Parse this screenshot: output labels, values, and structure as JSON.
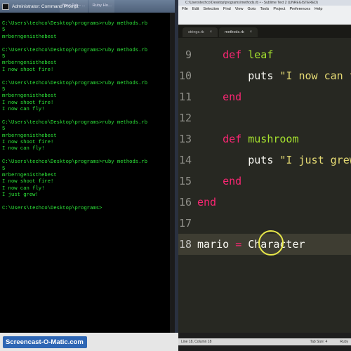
{
  "cmd": {
    "title": "Administrator: Command Prompt",
    "lines": [
      "C:\\Users\\techco\\Desktop\\programs>ruby methods.rb",
      "5",
      "mrberngenisthebest",
      "",
      "C:\\Users\\techco\\Desktop\\programs>ruby methods.rb",
      "5",
      "mrberngenisthebest",
      "I now shoot fire!",
      "",
      "C:\\Users\\techco\\Desktop\\programs>ruby methods.rb",
      "5",
      "mrberngenisthebest",
      "I now shoot fire!",
      "I now can fly!",
      "",
      "C:\\Users\\techco\\Desktop\\programs>ruby methods.rb",
      "5",
      "mrberngenisthebest",
      "I now shoot fire!",
      "I now can fly!",
      "",
      "C:\\Users\\techco\\Desktop\\programs>ruby methods.rb",
      "5",
      "mrberngenisthebest",
      "I now shoot fire!",
      "I now can fly!",
      "I just grew!",
      "",
      "C:\\Users\\techco\\Desktop\\programs>"
    ]
  },
  "taskbar_peek": [
    "New Tab - ...",
    "Ruby Ho..."
  ],
  "sublime": {
    "title": "C:\\Users\\techco\\Desktop\\programs\\methods.rb • - Sublime Text 2 (UNREGISTERED)",
    "menus": [
      "File",
      "Edit",
      "Selection",
      "Find",
      "View",
      "Goto",
      "Tools",
      "Project",
      "Preferences",
      "Help"
    ],
    "tabs": [
      {
        "label": "strings.rb",
        "close": "×"
      },
      {
        "label": "methods.rb",
        "close": "×"
      }
    ],
    "lines": [
      {
        "n": "9",
        "indent": "    ",
        "parts": [
          [
            "kw",
            "def"
          ],
          [
            "txt",
            " "
          ],
          [
            "fn",
            "leaf"
          ]
        ]
      },
      {
        "n": "10",
        "indent": "        ",
        "parts": [
          [
            "txt",
            "puts "
          ],
          [
            "str",
            "\"I now can fly!\""
          ]
        ]
      },
      {
        "n": "11",
        "indent": "    ",
        "parts": [
          [
            "kw",
            "end"
          ]
        ]
      },
      {
        "n": "12",
        "indent": "",
        "parts": []
      },
      {
        "n": "13",
        "indent": "    ",
        "parts": [
          [
            "kw",
            "def"
          ],
          [
            "txt",
            " "
          ],
          [
            "fn",
            "mushroom"
          ]
        ]
      },
      {
        "n": "14",
        "indent": "        ",
        "parts": [
          [
            "txt",
            "puts "
          ],
          [
            "str",
            "\"I just grew!\""
          ]
        ]
      },
      {
        "n": "15",
        "indent": "    ",
        "parts": [
          [
            "kw",
            "end"
          ]
        ]
      },
      {
        "n": "16",
        "indent": "",
        "parts": [
          [
            "kw",
            "end"
          ]
        ]
      },
      {
        "n": "17",
        "indent": "",
        "parts": []
      },
      {
        "n": "18",
        "indent": "",
        "parts": [
          [
            "txt",
            "mario "
          ],
          [
            "op",
            "="
          ],
          [
            "txt",
            " Character"
          ]
        ]
      }
    ],
    "current_line": "18",
    "status": {
      "position": "Line 18, Column 18",
      "tab_size": "Tab Size: 4",
      "syntax": "Ruby"
    }
  },
  "watermark": "Screencast-O-Matic.com",
  "colors": {
    "terminal_text": "#2eea3a",
    "keyword": "#f92672",
    "function_name": "#a6e22e",
    "string": "#e6db74",
    "cursor_highlight": "#e8e84a"
  }
}
